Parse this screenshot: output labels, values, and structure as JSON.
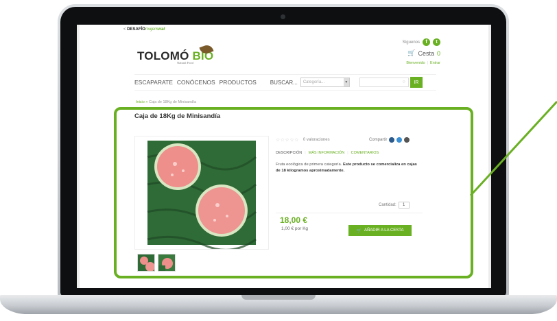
{
  "site": {
    "topnote": {
      "prefix": "< ",
      "desafio": "DESAFÍO",
      "mujer": "mujer",
      "rural": "rural"
    },
    "logo": {
      "name": "TOLOMÓ",
      "bio": "BIO",
      "sub": "Natural Food"
    },
    "social_label": "Síguenos",
    "social_icons": [
      "facebook-icon",
      "twitter-icon"
    ],
    "cart_label": "Cesta",
    "cart_count": "0",
    "welcome": "Bienvenido",
    "login": "Entrar"
  },
  "nav": {
    "items": [
      "ESCAPARATE",
      "CONÓCENOS",
      "PRODUCTOS"
    ],
    "search_label": "BUSCAR...",
    "category_placeholder": "Categoría...",
    "search_button": "IR"
  },
  "breadcrumb": {
    "home": "Inicio",
    "sep": "»",
    "current": "Caja de 18Kg de Minisandía"
  },
  "product": {
    "title": "Caja de 18Kg de Minisandía",
    "ratings_text": "0 valoraciones",
    "share_label": "Compartir",
    "tabs": [
      "DESCRIPCIÓN",
      "MÁS INFORMACIÓN",
      "COMENTARIOS"
    ],
    "desc_plain": "Fruta ecológica de primera categoría. ",
    "desc_bold": "Este producto se comercializa en cajas de 18 kilogramos aproximadamente.",
    "qty_label": "Cantidad:",
    "qty_value": "1",
    "price": "18,00 €",
    "unit_price": "1,00 € por Kg",
    "add_button": "AÑADIR A LA CESTA"
  },
  "colors": {
    "accent": "#6ab023",
    "bezel": "#0e0f11"
  }
}
